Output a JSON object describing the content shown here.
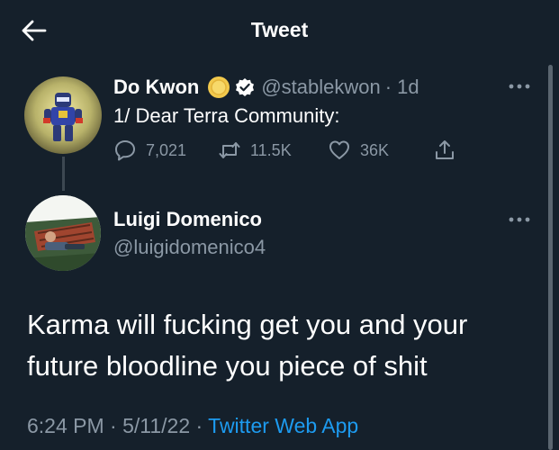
{
  "header": {
    "title": "Tweet"
  },
  "tweet": {
    "author_name": "Do Kwon",
    "author_handle": "@stablekwon",
    "time": "· 1d",
    "text": "1/ Dear Terra Community:",
    "replies": "7,021",
    "retweets": "11.5K",
    "likes": "36K"
  },
  "reply": {
    "author_name": "Luigi Domenico",
    "author_handle": "@luigidomenico4",
    "text": "Karma will fucking get you and your future bloodline you piece of shit",
    "time": "6:24 PM",
    "sep1": " · ",
    "date": "5/11/22",
    "sep2": " · ",
    "source": "Twitter Web App"
  },
  "icons": {
    "back": "arrow-left",
    "verified": "verified-badge",
    "coin": "gold-coin",
    "reply": "speech-bubble",
    "retweet": "retweet",
    "like": "heart",
    "share": "share",
    "more": "three-dots"
  },
  "colors": {
    "background": "#15202b",
    "secondary_text": "#8b98a5",
    "link": "#1d9bf0"
  }
}
